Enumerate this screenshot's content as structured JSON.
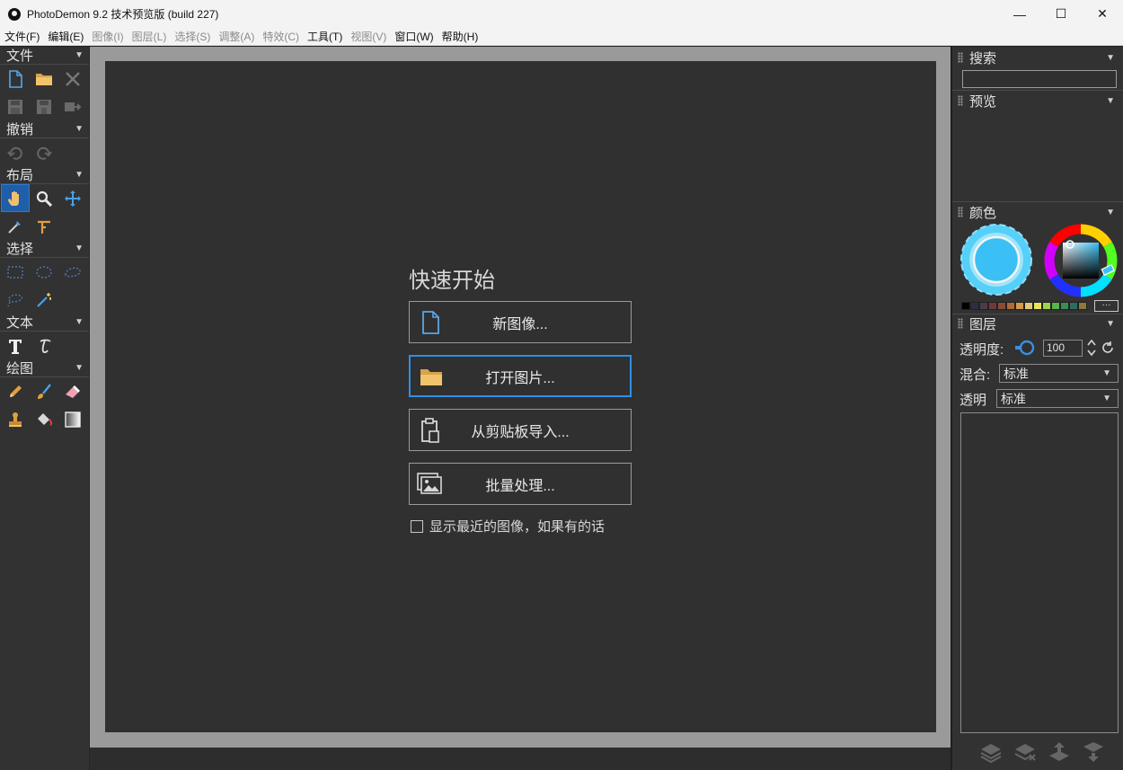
{
  "window": {
    "title": "PhotoDemon 9.2 技术预览版 (build 227)",
    "minimize": "—",
    "maximize": "☐",
    "close": "✕"
  },
  "menu": [
    {
      "label": "文件(F)",
      "enabled": true
    },
    {
      "label": "编辑(E)",
      "enabled": true
    },
    {
      "label": "图像(I)",
      "enabled": false
    },
    {
      "label": "图层(L)",
      "enabled": false
    },
    {
      "label": "选择(S)",
      "enabled": false
    },
    {
      "label": "调整(A)",
      "enabled": false
    },
    {
      "label": "特效(C)",
      "enabled": false
    },
    {
      "label": "工具(T)",
      "enabled": true
    },
    {
      "label": "视图(V)",
      "enabled": false
    },
    {
      "label": "窗口(W)",
      "enabled": true
    },
    {
      "label": "帮助(H)",
      "enabled": true
    }
  ],
  "toolbox": {
    "sections": {
      "file": "文件",
      "undo": "撤销",
      "layout": "布局",
      "select": "选择",
      "text": "文本",
      "paint": "绘图"
    },
    "icons": [
      "new-file-icon",
      "open-folder-icon",
      "close-icon",
      "save-icon",
      "save-as-icon",
      "export-icon",
      "undo-icon",
      "redo-icon",
      "hand-icon",
      "zoom-icon",
      "move-icon",
      "color-picker-icon",
      "measure-icon",
      "rect-select-icon",
      "ellipse-select-icon",
      "lasso-select-icon",
      "polygon-lasso-icon",
      "magic-wand-icon",
      "text-icon",
      "typography-icon",
      "pencil-icon",
      "brush-icon",
      "eraser-icon",
      "clone-stamp-icon",
      "fill-bucket-icon",
      "gradient-icon"
    ]
  },
  "quickstart": {
    "title": "快速开始",
    "new_image": "新图像...",
    "open_image": "打开图片...",
    "import_clipboard": "从剪贴板导入...",
    "batch_process": "批量处理...",
    "recent_label": "显示最近的图像，如果有的话",
    "recent_checked": false
  },
  "panels": {
    "search": "搜索",
    "search_value": "",
    "preview": "预览",
    "colors": "颜色",
    "layers": "图层",
    "opacity_label": "透明度:",
    "opacity_value": "100",
    "blend_label": "混合:",
    "blend_value": "标准",
    "alpha_label": "透明",
    "alpha_value": "标准",
    "more_colors": "···"
  },
  "colors": {
    "accent": "#2f8fe6",
    "primary_color": "#3ac0f5",
    "swatches": [
      "#000000",
      "#2a2f44",
      "#4e3a4c",
      "#6c3b3f",
      "#8a4b34",
      "#b06a36",
      "#d29a4a",
      "#e3c87a",
      "#e8e45a",
      "#9bd34f",
      "#59b24a",
      "#3e8b56",
      "#2f6c60",
      "#8a7b3a"
    ]
  }
}
